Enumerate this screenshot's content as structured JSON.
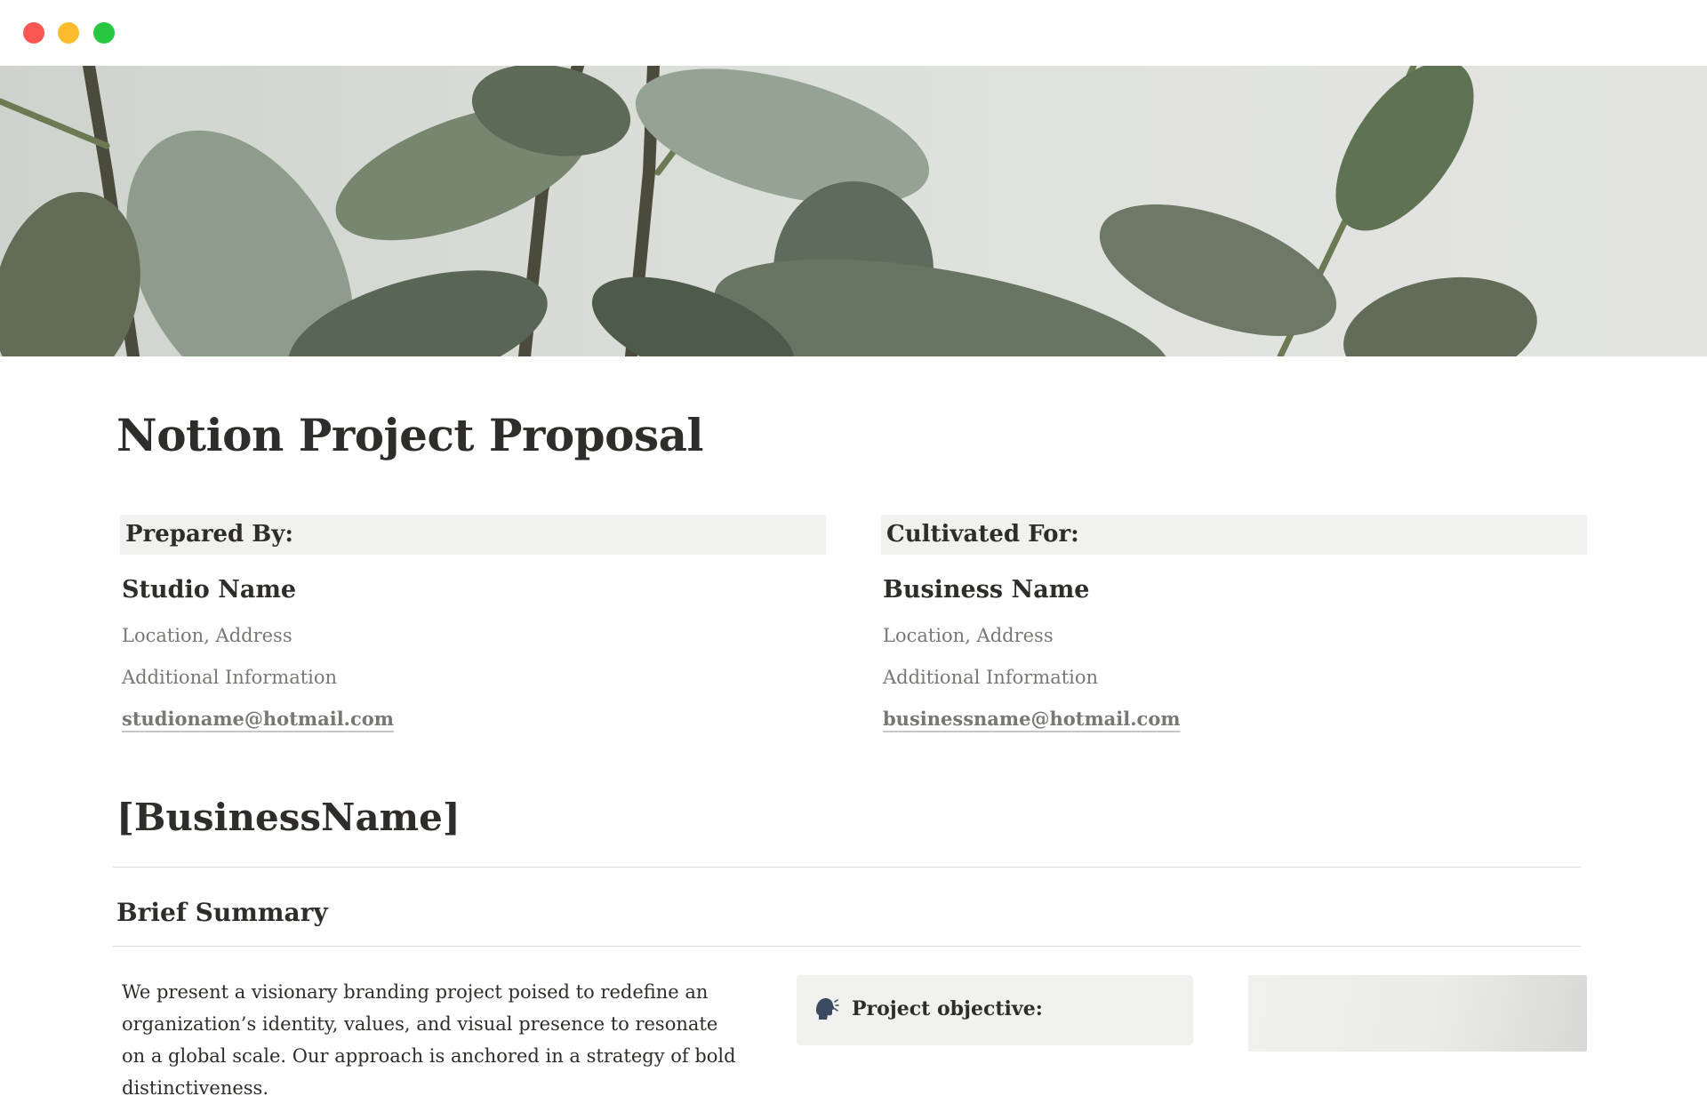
{
  "window": {
    "controls": [
      "close",
      "minimize",
      "zoom"
    ]
  },
  "cover": {
    "image": "rubber-plant-leaves-photo"
  },
  "page": {
    "title": "Notion Project Proposal"
  },
  "prepared_by": {
    "header": "Prepared By:",
    "name": "Studio Name",
    "address": "Location, Address",
    "info": "Additional Information",
    "email": "studioname@hotmail.com"
  },
  "cultivated_for": {
    "header": "Cultivated For:",
    "name": "Business Name",
    "address": "Location, Address",
    "info": "Additional Information",
    "email": "businessname@hotmail.com"
  },
  "section": {
    "heading": "[BusinessName]",
    "subheading": "Brief Summary",
    "summary": "We present a visionary branding project poised to redefine an organization’s identity, values, and visual presence to resonate on a global scale. Our approach is anchored in a strategy of bold distinctiveness."
  },
  "callout": {
    "icon": "speaking-head-icon",
    "label": "Project objective:"
  },
  "colors": {
    "accent_bg": "#f1f1ef",
    "text": "#2f2d29",
    "muted": "#787773"
  }
}
